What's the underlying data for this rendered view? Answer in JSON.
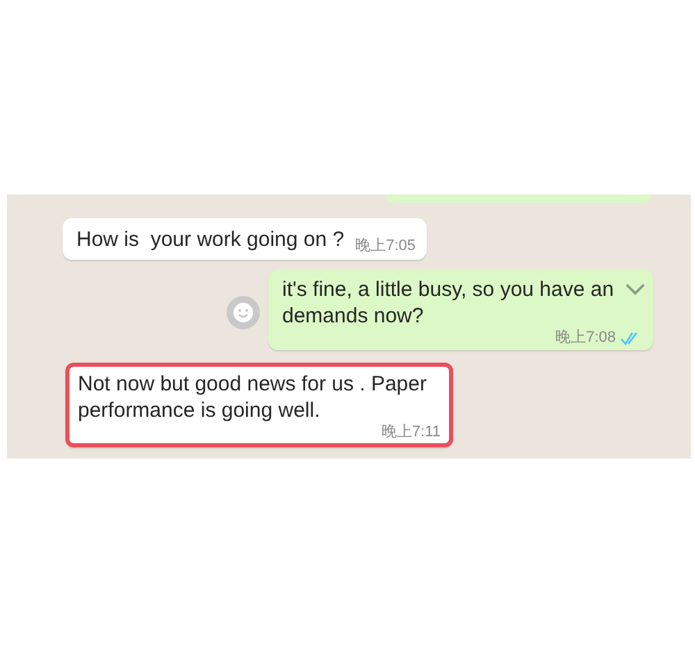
{
  "messages": [
    {
      "kind": "incoming",
      "highlighted": false,
      "lines": [
        "How is  your work going on ?"
      ],
      "time": "晚上7:05"
    },
    {
      "kind": "outgoing",
      "highlighted": false,
      "lines": [
        "it's fine, a little busy, so you have an",
        "demands now?"
      ],
      "time": "晚上7:08",
      "read": true
    },
    {
      "kind": "incoming",
      "highlighted": true,
      "lines": [
        "Not now but good news for us . Paper",
        "performance is going well."
      ],
      "time": "晚上7:11"
    }
  ]
}
